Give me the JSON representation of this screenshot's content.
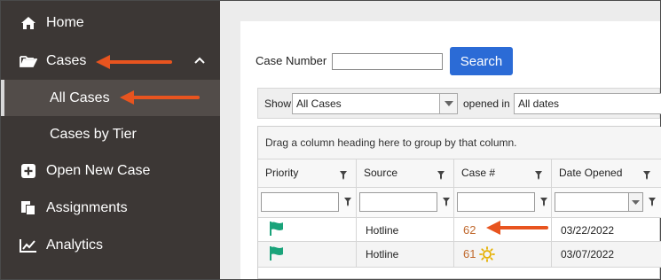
{
  "sidebar": {
    "items": [
      {
        "label": "Home",
        "icon": "home-icon"
      },
      {
        "label": "Cases",
        "icon": "folder-open-icon",
        "expanded": true
      },
      {
        "label": "All Cases",
        "sub": true,
        "active": true
      },
      {
        "label": "Cases by Tier",
        "sub": true
      },
      {
        "label": "Open New Case",
        "icon": "plus-square-icon"
      },
      {
        "label": "Assignments",
        "icon": "documents-icon"
      },
      {
        "label": "Analytics",
        "icon": "line-chart-icon"
      }
    ]
  },
  "search": {
    "case_number_label": "Case Number",
    "case_number_value": "",
    "button_label": "Search"
  },
  "filters": {
    "show_label": "Show",
    "show_value": "All Cases",
    "opened_in_label": "opened in",
    "opened_in_value": "All dates"
  },
  "grid": {
    "group_hint": "Drag a column heading here to group by that column.",
    "columns": [
      "Priority",
      "Source",
      "Case #",
      "Date Opened"
    ],
    "rows": [
      {
        "priority": "flag",
        "source": "Hotline",
        "case_number": "62",
        "date_opened": "03/22/2022"
      },
      {
        "priority": "flag",
        "source": "Hotline",
        "case_number": "61",
        "date_opened": "03/07/2022"
      }
    ]
  },
  "colors": {
    "sidebar_bg": "#3c3735",
    "accent_blue": "#2b6bd6",
    "flag_green": "#1aa37a",
    "link_orange": "#c0692e",
    "annotation_arrow": "#e8541f",
    "sun_gold": "#e5b000"
  }
}
